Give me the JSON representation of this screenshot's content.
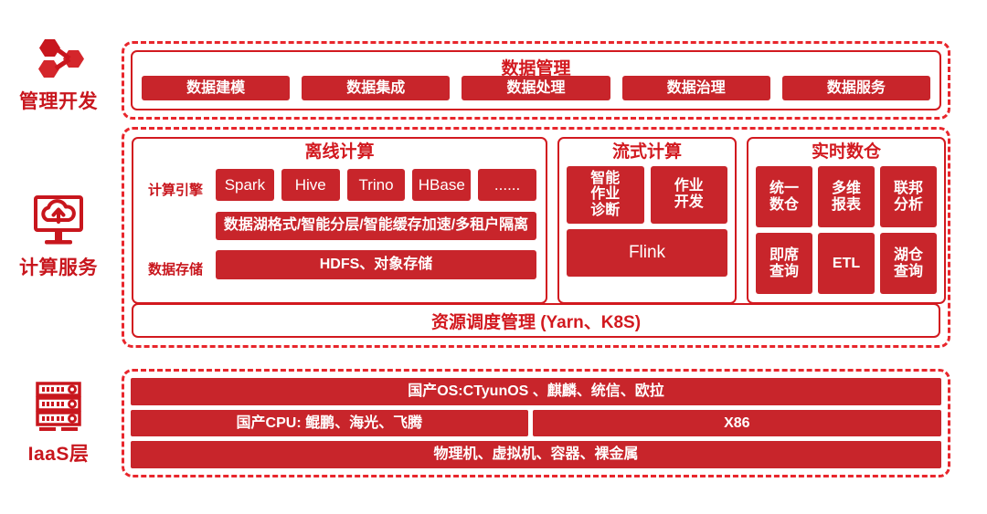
{
  "theme": {
    "red_fill": "#C8252B",
    "red_border": "#D2191F",
    "red_dashed": "#E8262C",
    "red_text": "#C8161D",
    "white": "#FFFFFF"
  },
  "rail": [
    {
      "id": "manage",
      "label": "管理开发",
      "icon": "node-graph-icon"
    },
    {
      "id": "compute",
      "label": "计算服务",
      "icon": "cloud-monitor-icon"
    },
    {
      "id": "iaas",
      "label": "IaaS层",
      "icon": "server-rack-icon"
    }
  ],
  "management": {
    "title": "数据管理",
    "items": [
      "数据建模",
      "数据集成",
      "数据处理",
      "数据治理",
      "数据服务"
    ]
  },
  "compute": {
    "offline": {
      "title": "离线计算",
      "engine_label": "计算引擎",
      "engines": [
        "Spark",
        "Hive",
        "Trino",
        "HBase",
        "......"
      ],
      "lake_bar": "数据湖格式/智能分层/智能缓存加速/多租户隔离",
      "storage_label": "数据存储",
      "storage_bar": "HDFS、对象存储"
    },
    "streaming": {
      "title": "流式计算",
      "top_items": [
        "智能\n作业\n诊断",
        "作业\n开发"
      ],
      "engine": "Flink"
    },
    "realtime_dw": {
      "title": "实时数仓",
      "items": [
        "统一\n数仓",
        "多维\n报表",
        "联邦\n分析",
        "即席\n查询",
        "ETL",
        "湖仓\n查询"
      ]
    },
    "resource_bar": "资源调度管理 (Yarn、K8S)"
  },
  "iaas": {
    "os_row": "国产OS:CTyunOS 、麒麟、统信、欧拉",
    "cpu_domestic": "国产CPU: 鲲鹏、海光、飞腾",
    "cpu_x86": "X86",
    "infra_row": "物理机、虚拟机、容器、裸金属"
  }
}
